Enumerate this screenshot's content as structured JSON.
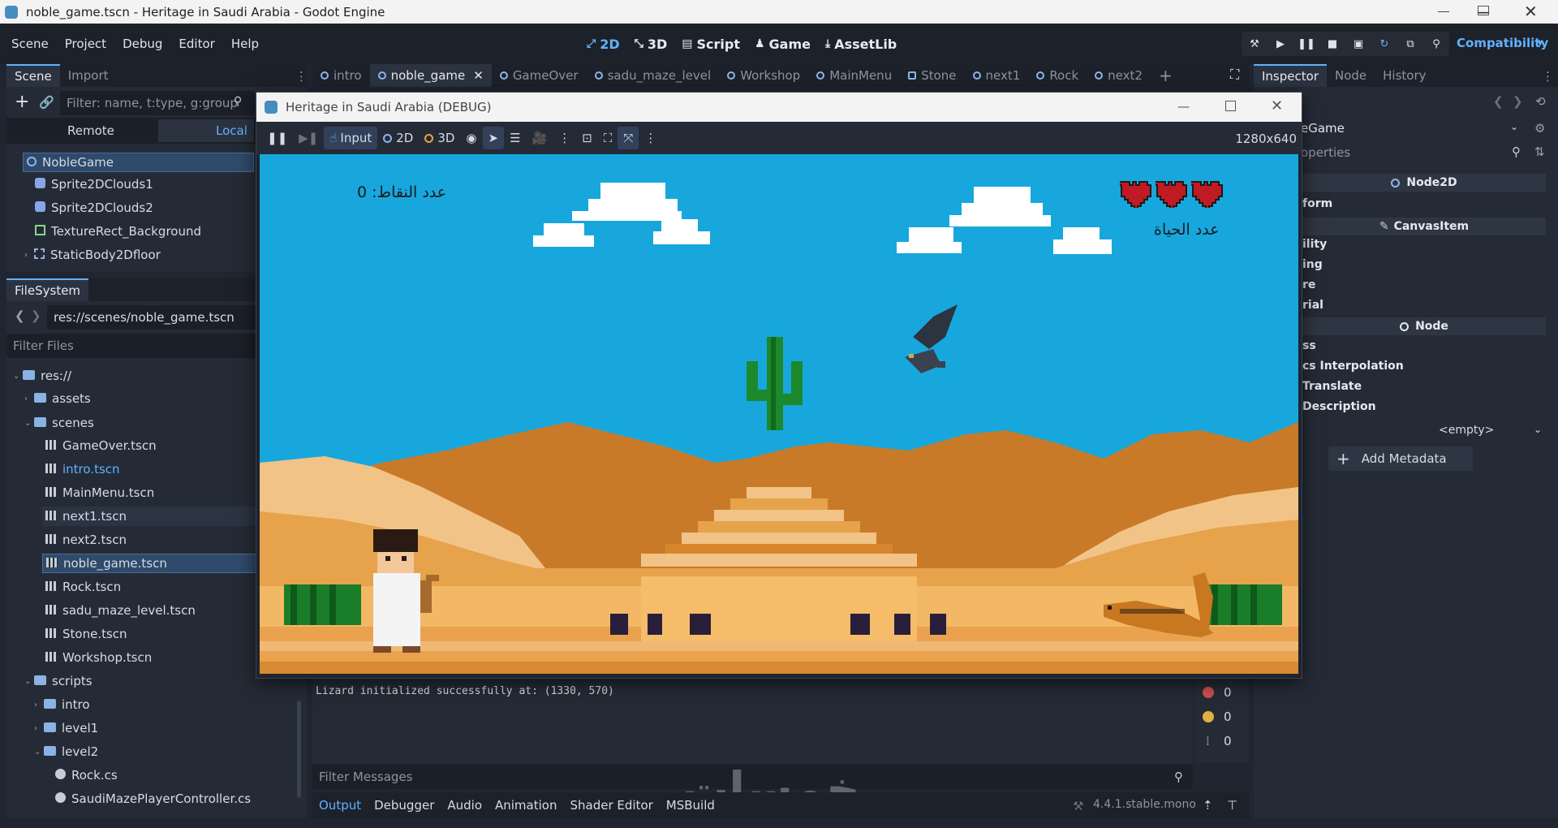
{
  "window": {
    "title": "noble_game.tscn - Heritage in Saudi Arabia - Godot Engine"
  },
  "menus": [
    "Scene",
    "Project",
    "Debug",
    "Editor",
    "Help"
  ],
  "main_screens": [
    {
      "label": "2D",
      "icon": "2d-icon",
      "active": true
    },
    {
      "label": "3D",
      "icon": "3d-icon",
      "active": false
    },
    {
      "label": "Script",
      "icon": "script-icon",
      "active": false
    },
    {
      "label": "Game",
      "icon": "game-icon",
      "active": false
    },
    {
      "label": "AssetLib",
      "icon": "assetlib-icon",
      "active": false
    }
  ],
  "renderer": "Compatibility",
  "scene_dock": {
    "tabs": [
      "Scene",
      "Import"
    ],
    "filter_placeholder": "Filter: name, t:type, g:group",
    "remote_label": "Remote",
    "local_label": "Local",
    "nodes": [
      {
        "name": "NobleGame",
        "type": "Node2D"
      },
      {
        "name": "Sprite2DClouds1",
        "type": "Sprite2D"
      },
      {
        "name": "Sprite2DClouds2",
        "type": "Sprite2D"
      },
      {
        "name": "TextureRect_Background",
        "type": "TextureRect"
      },
      {
        "name": "StaticBody2Dfloor",
        "type": "StaticBody2D"
      }
    ]
  },
  "filesystem": {
    "tab": "FileSystem",
    "path": "res://scenes/noble_game.tscn",
    "filter_placeholder": "Filter Files",
    "items": [
      {
        "label": "res://",
        "kind": "folder"
      },
      {
        "label": "assets",
        "kind": "folder"
      },
      {
        "label": "scenes",
        "kind": "folder"
      },
      {
        "label": "GameOver.tscn",
        "kind": "scene"
      },
      {
        "label": "intro.tscn",
        "kind": "scene"
      },
      {
        "label": "MainMenu.tscn",
        "kind": "scene"
      },
      {
        "label": "next1.tscn",
        "kind": "scene"
      },
      {
        "label": "next2.tscn",
        "kind": "scene"
      },
      {
        "label": "noble_game.tscn",
        "kind": "scene"
      },
      {
        "label": "Rock.tscn",
        "kind": "scene"
      },
      {
        "label": "sadu_maze_level.tscn",
        "kind": "scene"
      },
      {
        "label": "Stone.tscn",
        "kind": "scene"
      },
      {
        "label": "Workshop.tscn",
        "kind": "scene"
      },
      {
        "label": "scripts",
        "kind": "folder"
      },
      {
        "label": "intro",
        "kind": "folder"
      },
      {
        "label": "level1",
        "kind": "folder"
      },
      {
        "label": "level2",
        "kind": "folder"
      },
      {
        "label": "Rock.cs",
        "kind": "cs"
      },
      {
        "label": "SaudiMazePlayerController.cs",
        "kind": "cs"
      }
    ]
  },
  "scene_tabs": [
    "intro",
    "noble_game",
    "GameOver",
    "sadu_maze_level",
    "Workshop",
    "MainMenu",
    "Stone",
    "next1",
    "Rock",
    "next2"
  ],
  "debug_window": {
    "title": "Heritage in Saudi Arabia (DEBUG)",
    "input_label": "Input",
    "mode_2d": "2D",
    "mode_3d": "3D",
    "resolution": "1280x640"
  },
  "game": {
    "score_text": "عدد النقاط: 0",
    "lives_text": "عدد الحياة",
    "lives": 3
  },
  "inspector": {
    "tabs": [
      "Inspector",
      "Node",
      "History"
    ],
    "object_name": "eGame",
    "filter_placeholder": "operties",
    "sections": [
      "Node2D",
      "CanvasItem",
      "Node"
    ],
    "rows": [
      "form",
      "ility",
      "ing",
      "re",
      "rial",
      "ss",
      "cs Interpolation",
      "Translate",
      "Description"
    ],
    "metadata_value": "<empty>",
    "add_metadata_label": "Add Metadata"
  },
  "output": {
    "line1": "Lizard initialized successfully at: (1330, 570)",
    "filter_placeholder": "Filter Messages",
    "error_count": "0",
    "warning_count": "0",
    "message_count": "0"
  },
  "bottom_tabs": [
    "Output",
    "Debugger",
    "Audio",
    "Animation",
    "Shader Editor",
    "MSBuild"
  ],
  "version": "4.4.1.stable.mono",
  "watermark": "خمسات",
  "colors": {
    "accent": "#5fb2ff",
    "sky": "#18a8e0",
    "sand_light": "#f1c386",
    "sand_mid": "#e7a24c",
    "sand_dark": "#c97a28"
  }
}
